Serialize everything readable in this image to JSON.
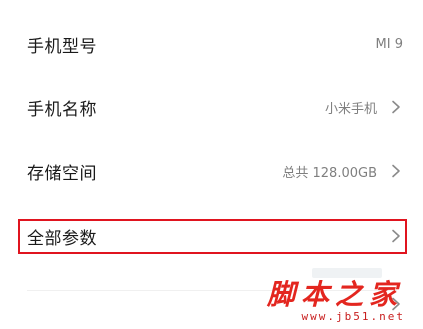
{
  "settings": {
    "rows": [
      {
        "label": "手机型号",
        "value": "MI 9",
        "has_chevron": false
      },
      {
        "label": "手机名称",
        "value": "小米手机",
        "has_chevron": true
      },
      {
        "label": "存储空间",
        "value": "总共 128.00GB",
        "has_chevron": true
      },
      {
        "label": "全部参数",
        "value": "",
        "has_chevron": true,
        "highlighted": true
      }
    ]
  },
  "highlight_color": "#e0141f",
  "watermark": {
    "title": "脚本之家",
    "url": "www.jb51.net",
    "color": "#e3261f"
  },
  "icons": {
    "chevron": "chevron-right-icon"
  }
}
